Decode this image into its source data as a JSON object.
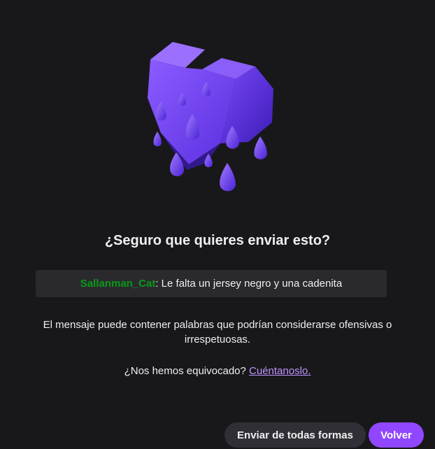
{
  "dialog": {
    "title": "¿Seguro que quieres enviar esto?",
    "message": {
      "username": "Sallanman_Cat",
      "separator": ":",
      "text": " Le falta un jersey negro y una cadenita"
    },
    "warning": "El mensaje puede contener palabras que podrían considerarse ofensivas o irrespetuosas.",
    "feedback": {
      "question": "¿Nos hemos equivocado? ",
      "link_label": "Cuéntanoslo."
    },
    "buttons": {
      "send_anyway": "Enviar de todas formas",
      "back": "Volver"
    }
  },
  "illustration": {
    "icon": "melting-heart-icon",
    "color": "#6c3cf5"
  },
  "colors": {
    "background": "#18181b",
    "message_box": "#2a2a2e",
    "username": "#0a9a19",
    "link": "#bf94ff",
    "primary_button": "#9147ff",
    "secondary_button": "#2f2f35"
  }
}
